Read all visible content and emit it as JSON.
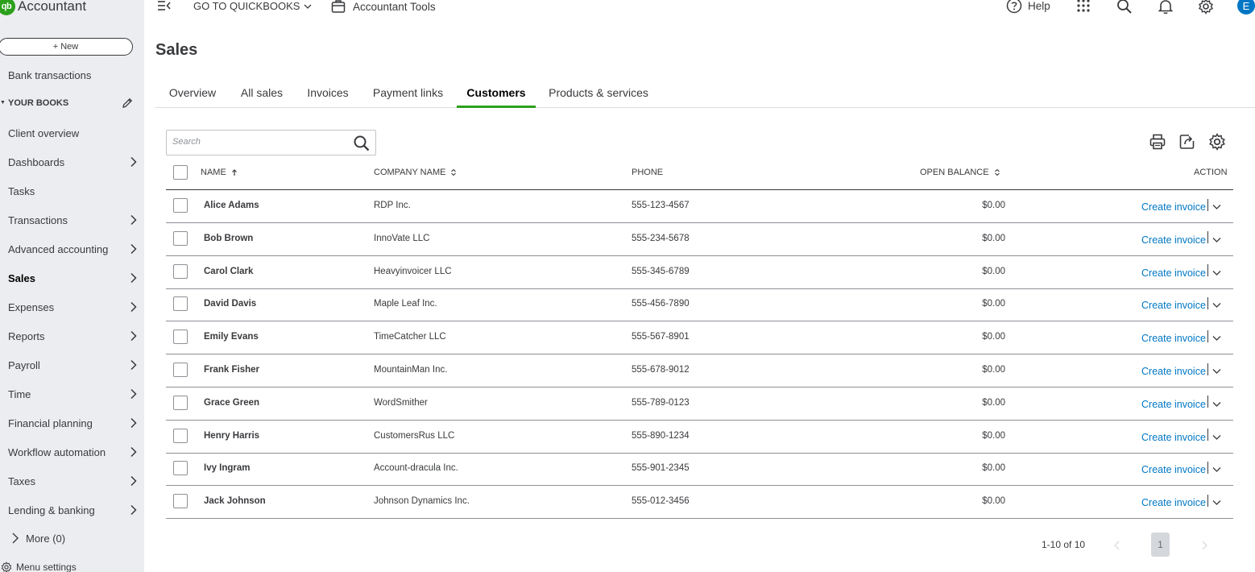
{
  "brand": {
    "logo": "qb",
    "name": "Accountant"
  },
  "sidebar": {
    "new_label": "+  New",
    "partial_item": "Bank transactions",
    "section_title": "YOUR BOOKS",
    "items": [
      {
        "label": "Client overview",
        "chevron": false
      },
      {
        "label": "Dashboards",
        "chevron": true
      },
      {
        "label": "Tasks",
        "chevron": false
      },
      {
        "label": "Transactions",
        "chevron": true
      },
      {
        "label": "Advanced accounting",
        "chevron": true
      },
      {
        "label": "Sales",
        "chevron": true,
        "active": true
      },
      {
        "label": "Expenses",
        "chevron": true
      },
      {
        "label": "Reports",
        "chevron": true
      },
      {
        "label": "Payroll",
        "chevron": true
      },
      {
        "label": "Time",
        "chevron": true
      },
      {
        "label": "Financial planning",
        "chevron": true
      },
      {
        "label": "Workflow automation",
        "chevron": true
      },
      {
        "label": "Taxes",
        "chevron": true
      },
      {
        "label": "Lending & banking",
        "chevron": true
      }
    ],
    "more_label": "More (0)",
    "menu_settings": "Menu settings"
  },
  "topbar": {
    "goto_label": "GO TO QUICKBOOKS",
    "accountant_tools": "Accountant Tools",
    "help_label": "Help",
    "avatar_initial": "E"
  },
  "page": {
    "title": "Sales",
    "tabs": [
      {
        "label": "Overview"
      },
      {
        "label": "All sales"
      },
      {
        "label": "Invoices"
      },
      {
        "label": "Payment links"
      },
      {
        "label": "Customers",
        "active": true
      },
      {
        "label": "Products & services"
      }
    ]
  },
  "search": {
    "placeholder": "Search"
  },
  "table": {
    "headers": {
      "name": "NAME",
      "company": "COMPANY NAME",
      "phone": "PHONE",
      "balance": "OPEN BALANCE",
      "action": "ACTION"
    },
    "rows": [
      {
        "name": "Alice Adams",
        "company": "RDP Inc.",
        "phone": "555-123-4567",
        "balance": "$0.00",
        "action": "Create invoice"
      },
      {
        "name": "Bob Brown",
        "company": "InnoVate LLC",
        "phone": "555-234-5678",
        "balance": "$0.00",
        "action": "Create invoice"
      },
      {
        "name": "Carol Clark",
        "company": "Heavyinvoicer LLC",
        "phone": "555-345-6789",
        "balance": "$0.00",
        "action": "Create invoice"
      },
      {
        "name": "David Davis",
        "company": "Maple Leaf Inc.",
        "phone": "555-456-7890",
        "balance": "$0.00",
        "action": "Create invoice"
      },
      {
        "name": "Emily Evans",
        "company": "TimeCatcher LLC",
        "phone": "555-567-8901",
        "balance": "$0.00",
        "action": "Create invoice"
      },
      {
        "name": "Frank Fisher",
        "company": "MountainMan Inc.",
        "phone": "555-678-9012",
        "balance": "$0.00",
        "action": "Create invoice"
      },
      {
        "name": "Grace Green",
        "company": "WordSmither",
        "phone": "555-789-0123",
        "balance": "$0.00",
        "action": "Create invoice"
      },
      {
        "name": "Henry Harris",
        "company": "CustomersRus LLC",
        "phone": "555-890-1234",
        "balance": "$0.00",
        "action": "Create invoice"
      },
      {
        "name": "Ivy Ingram",
        "company": "Account-dracula Inc.",
        "phone": "555-901-2345",
        "balance": "$0.00",
        "action": "Create invoice"
      },
      {
        "name": "Jack Johnson",
        "company": "Johnson Dynamics Inc.",
        "phone": "555-012-3456",
        "balance": "$0.00",
        "action": "Create invoice"
      }
    ]
  },
  "pagination": {
    "range": "1-10 of 10",
    "current": "1"
  },
  "colors": {
    "brand_green": "#2ca01c",
    "link_blue": "#0077c5",
    "sidebar_bg": "#ecedf0",
    "text": "#393a3d"
  }
}
